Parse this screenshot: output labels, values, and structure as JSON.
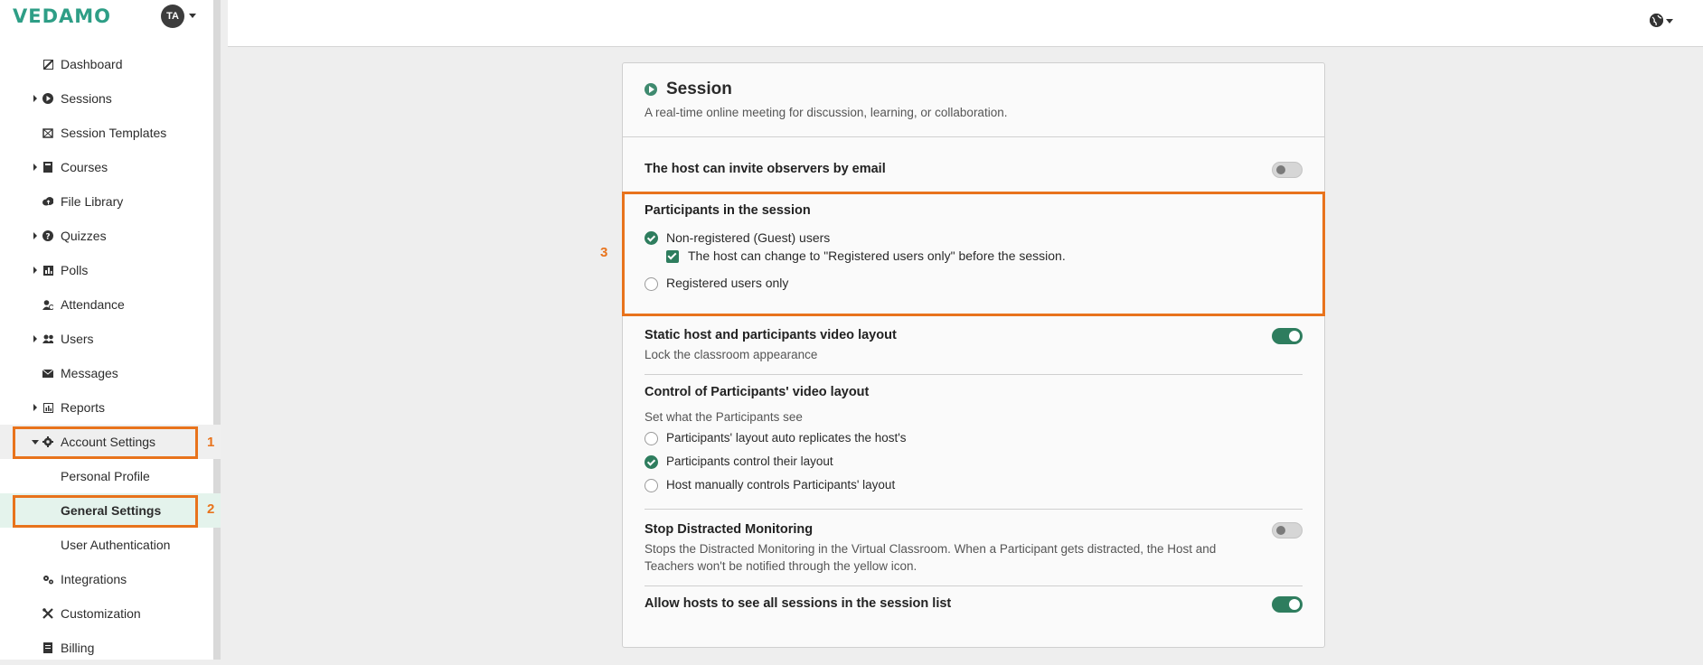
{
  "app": {
    "logo": "VEDAMO",
    "avatar_initials": "TA"
  },
  "sidebar": {
    "items": [
      {
        "label": "Dashboard",
        "icon": "dashboard-icon",
        "has_caret": false
      },
      {
        "label": "Sessions",
        "icon": "play-circle-icon",
        "has_caret": true
      },
      {
        "label": "Session Templates",
        "icon": "template-icon",
        "has_caret": false
      },
      {
        "label": "Courses",
        "icon": "book-icon",
        "has_caret": true
      },
      {
        "label": "File Library",
        "icon": "cloud-icon",
        "has_caret": false
      },
      {
        "label": "Quizzes",
        "icon": "question-icon",
        "has_caret": true
      },
      {
        "label": "Polls",
        "icon": "bar-chart-icon",
        "has_caret": true
      },
      {
        "label": "Attendance",
        "icon": "user-check-icon",
        "has_caret": false
      },
      {
        "label": "Users",
        "icon": "users-icon",
        "has_caret": true
      },
      {
        "label": "Messages",
        "icon": "envelope-icon",
        "has_caret": false
      },
      {
        "label": "Reports",
        "icon": "report-icon",
        "has_caret": true
      },
      {
        "label": "Account Settings",
        "icon": "gear-icon",
        "has_caret": true,
        "expanded": true
      },
      {
        "label": "Personal Profile",
        "sub": true
      },
      {
        "label": "General Settings",
        "sub": true,
        "active": true
      },
      {
        "label": "User Authentication",
        "sub": true
      },
      {
        "label": "Integrations",
        "icon": "gears-icon",
        "has_caret": false
      },
      {
        "label": "Customization",
        "icon": "tools-icon",
        "has_caret": false
      },
      {
        "label": "Billing",
        "icon": "invoice-icon",
        "has_caret": false
      }
    ]
  },
  "annotations": {
    "one": "1",
    "two": "2",
    "three": "3"
  },
  "card": {
    "title": "Session",
    "subtitle": "A real-time online meeting for discussion, learning, or collaboration.",
    "invite_observers": {
      "label": "The host can invite observers by email",
      "enabled": false
    },
    "participants": {
      "title": "Participants in the session",
      "option_guest": "Non-registered (Guest) users",
      "option_guest_checkbox": "The host can change to \"Registered users only\" before the session.",
      "option_registered": "Registered users only"
    },
    "static_layout": {
      "title": "Static host and participants video layout",
      "desc": "Lock the classroom appearance",
      "enabled": true
    },
    "video_control": {
      "title": "Control of Participants' video layout",
      "desc": "Set what the Participants see",
      "opt1": "Participants' layout auto replicates the host's",
      "opt2": "Participants control their layout",
      "opt3": "Host manually controls Participants' layout"
    },
    "distracted": {
      "title": "Stop Distracted Monitoring",
      "desc": "Stops the Distracted Monitoring in the Virtual Classroom. When a Participant gets distracted, the Host and Teachers won't be notified through the yellow icon.",
      "enabled": false
    },
    "all_sessions": {
      "title": "Allow hosts to see all sessions in the session list",
      "enabled": true
    }
  },
  "colors": {
    "brand": "#2e9e86",
    "accent": "#2e7d5e",
    "highlight": "#e8731c"
  }
}
